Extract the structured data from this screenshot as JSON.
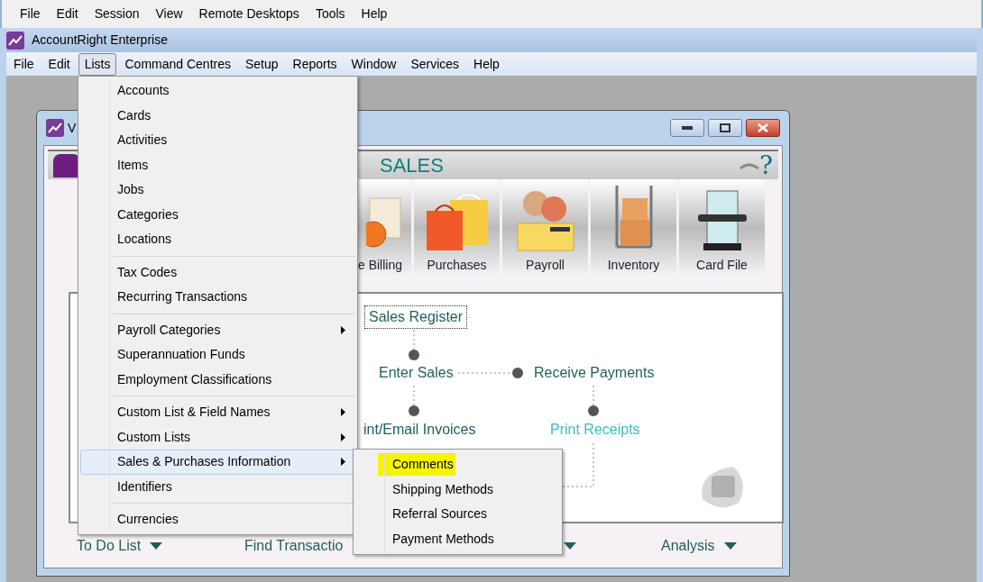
{
  "rdp_menu": [
    "File",
    "Edit",
    "Session",
    "View",
    "Remote Desktops",
    "Tools",
    "Help"
  ],
  "app": {
    "title": "AccountRight Enterprise"
  },
  "menu_bar": [
    {
      "label": "File",
      "selected": false
    },
    {
      "label": "Edit",
      "selected": false
    },
    {
      "label": "Lists",
      "selected": true
    },
    {
      "label": "Command Centres",
      "selected": false
    },
    {
      "label": "Setup",
      "selected": false
    },
    {
      "label": "Reports",
      "selected": false
    },
    {
      "label": "Window",
      "selected": false
    },
    {
      "label": "Services",
      "selected": false
    },
    {
      "label": "Help",
      "selected": false
    }
  ],
  "lists_menu": {
    "groups": [
      [
        {
          "label": "Accounts",
          "submenu": false,
          "selected": false
        },
        {
          "label": "Cards",
          "submenu": false,
          "selected": false
        },
        {
          "label": "Activities",
          "submenu": false,
          "selected": false
        },
        {
          "label": "Items",
          "submenu": false,
          "selected": false
        },
        {
          "label": "Jobs",
          "submenu": false,
          "selected": false
        },
        {
          "label": "Categories",
          "submenu": false,
          "selected": false
        },
        {
          "label": "Locations",
          "submenu": false,
          "selected": false
        }
      ],
      [
        {
          "label": "Tax Codes",
          "submenu": false,
          "selected": false
        },
        {
          "label": "Recurring Transactions",
          "submenu": false,
          "selected": false
        }
      ],
      [
        {
          "label": "Payroll Categories",
          "submenu": true,
          "selected": false
        },
        {
          "label": "Superannuation Funds",
          "submenu": false,
          "selected": false
        },
        {
          "label": "Employment Classifications",
          "submenu": false,
          "selected": false
        }
      ],
      [
        {
          "label": "Custom List & Field Names",
          "submenu": true,
          "selected": false
        },
        {
          "label": "Custom Lists",
          "submenu": true,
          "selected": false
        },
        {
          "label": "Sales & Purchases Information",
          "submenu": true,
          "selected": true
        },
        {
          "label": "Identifiers",
          "submenu": false,
          "selected": false
        }
      ],
      [
        {
          "label": "Currencies",
          "submenu": false,
          "selected": false
        }
      ]
    ]
  },
  "submenu": {
    "items": [
      {
        "label": "Comments",
        "highlighted": true
      },
      {
        "label": "Shipping Methods",
        "highlighted": false
      },
      {
        "label": "Referral Sources",
        "highlighted": false
      },
      {
        "label": "Payment Methods",
        "highlighted": false
      }
    ]
  },
  "sales_window": {
    "title": "V",
    "header": "SALES",
    "help_glyph": "?",
    "tiles": [
      {
        "label": "e Billing",
        "kind": "invoice"
      },
      {
        "label": "Purchases",
        "kind": "bags"
      },
      {
        "label": "Payroll",
        "kind": "people"
      },
      {
        "label": "Inventory",
        "kind": "truck"
      },
      {
        "label": "Card File",
        "kind": "cardfile"
      }
    ],
    "flow": [
      {
        "label": "Sales Register",
        "kind": "focused"
      },
      {
        "label": "Enter Sales",
        "kind": "link"
      },
      {
        "label": "Receive Payments",
        "kind": "link"
      },
      {
        "label": "int/Email Invoices",
        "kind": "link"
      },
      {
        "label": "Print Receipts",
        "kind": "visited"
      }
    ],
    "footer": [
      {
        "label": "To Do List",
        "caret": true
      },
      {
        "label": "Find Transactio",
        "caret": false
      },
      {
        "label": "Analysis",
        "caret": true
      }
    ]
  }
}
